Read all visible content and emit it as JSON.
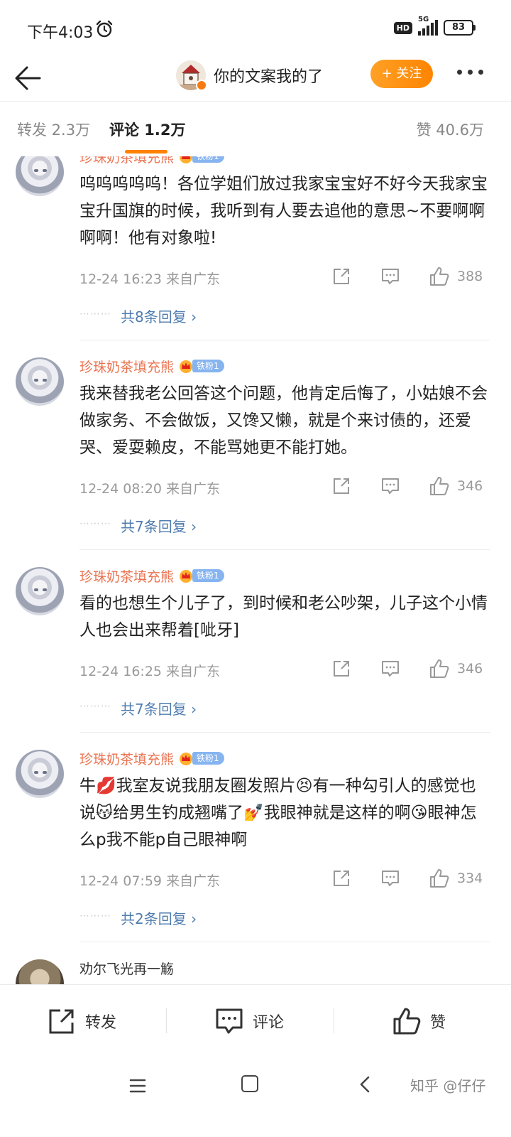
{
  "status_bar": {
    "time": "下午4:03",
    "network_badge": "HD",
    "network": "5G",
    "battery": "83"
  },
  "header": {
    "title": "你的文案我的了",
    "follow_label": "+ 关注"
  },
  "tabs": {
    "repost": "转发 2.3万",
    "comments": "评论 1.2万",
    "likes": "赞 40.6万"
  },
  "comments": [
    {
      "author": "珍珠奶茶填充熊",
      "badge": "铁粉1",
      "text": "呜呜呜呜呜！各位学姐们放过我家宝宝好不好今天我家宝宝升国旗的时候，我听到有人要去追他的意思~不要啊啊啊啊！他有对象啦!",
      "time_location": "12-24 16:23  来自广东",
      "likes": "388",
      "replies": "共8条回复 ›"
    },
    {
      "author": "珍珠奶茶填充熊",
      "badge": "铁粉1",
      "text": "我来替我老公回答这个问题，他肯定后悔了，小姑娘不会做家务、不会做饭，又馋又懒，就是个来讨债的，还爱哭、爱耍赖皮，不能骂她更不能打她。",
      "time_location": "12-24 08:20  来自广东",
      "likes": "346",
      "replies": "共7条回复 ›"
    },
    {
      "author": "珍珠奶茶填充熊",
      "badge": "铁粉1",
      "text": "看的也想生个儿子了，到时候和老公吵架，儿子这个小情人也会出来帮着[呲牙]",
      "time_location": "12-24 16:25  来自广东",
      "likes": "346",
      "replies": "共7条回复 ›"
    },
    {
      "author": "珍珠奶茶填充熊",
      "badge": "铁粉1",
      "text": "牛💋我室友说我朋友圈发照片😣有一种勾引人的感觉⁠也说😽给男生钓成翘嘴了💅我眼神就是这样的啊😘眼神怎么p我不能p自己眼神啊",
      "time_location": "12-24 07:59  来自广东",
      "likes": "334",
      "replies": "共2条回复 ›"
    },
    {
      "author": "劝尔飞光再一觞",
      "badge": "",
      "text": "",
      "time_location": "",
      "likes": "",
      "replies": ""
    }
  ],
  "bottom_bar": {
    "repost": "转发",
    "comment": "评论",
    "like": "赞"
  },
  "watermark": "知乎 @仔仔",
  "colors": {
    "accent": "#ff8200",
    "author": "#eb7350",
    "link": "#507daf",
    "fan_badge": "#86b4f0"
  },
  "icons": [
    "alarm-icon",
    "back-arrow-icon",
    "more-icon",
    "crown-icon",
    "share-icon",
    "comment-icon",
    "thumbs-up-icon",
    "menu-icon",
    "home-icon",
    "back-nav-icon"
  ]
}
